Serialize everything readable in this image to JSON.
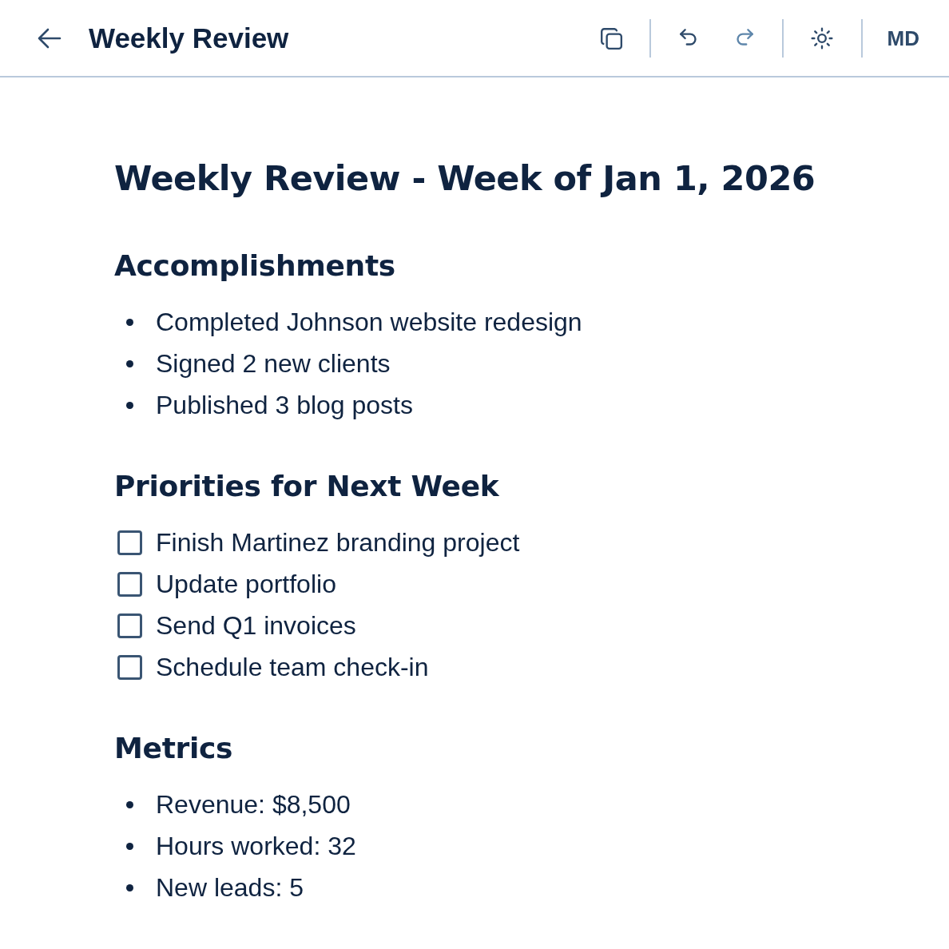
{
  "header": {
    "title": "Weekly Review",
    "toolbar_groups": [
      {
        "buttons": [
          {
            "kind": "copy",
            "disabled": false
          }
        ]
      },
      {
        "buttons": [
          {
            "kind": "undo",
            "disabled": false
          },
          {
            "kind": "redo",
            "disabled": true
          }
        ]
      },
      {
        "buttons": [
          {
            "kind": "theme",
            "disabled": false
          }
        ]
      }
    ],
    "user": {
      "initials": "MD"
    }
  },
  "document": {
    "title": "Weekly Review - Week of Jan 1, 2026",
    "sections": [
      {
        "heading": "Accomplishments",
        "kind": "bullets",
        "items": [
          {
            "text": "Completed Johnson website redesign"
          },
          {
            "text": "Signed 2 new clients"
          },
          {
            "text": "Published 3 blog posts"
          }
        ]
      },
      {
        "heading": "Priorities for Next Week",
        "kind": "checklist",
        "items": [
          {
            "text": "Finish Martinez branding project",
            "checked": false
          },
          {
            "text": "Update portfolio",
            "checked": false
          },
          {
            "text": "Send Q1 invoices",
            "checked": false
          },
          {
            "text": "Schedule team check-in",
            "checked": false
          }
        ]
      },
      {
        "heading": "Metrics",
        "kind": "bullets",
        "items": [
          {
            "text": "Revenue: $8,500"
          },
          {
            "text": "Hours worked: 32"
          },
          {
            "text": "New leads: 5"
          }
        ]
      }
    ]
  }
}
